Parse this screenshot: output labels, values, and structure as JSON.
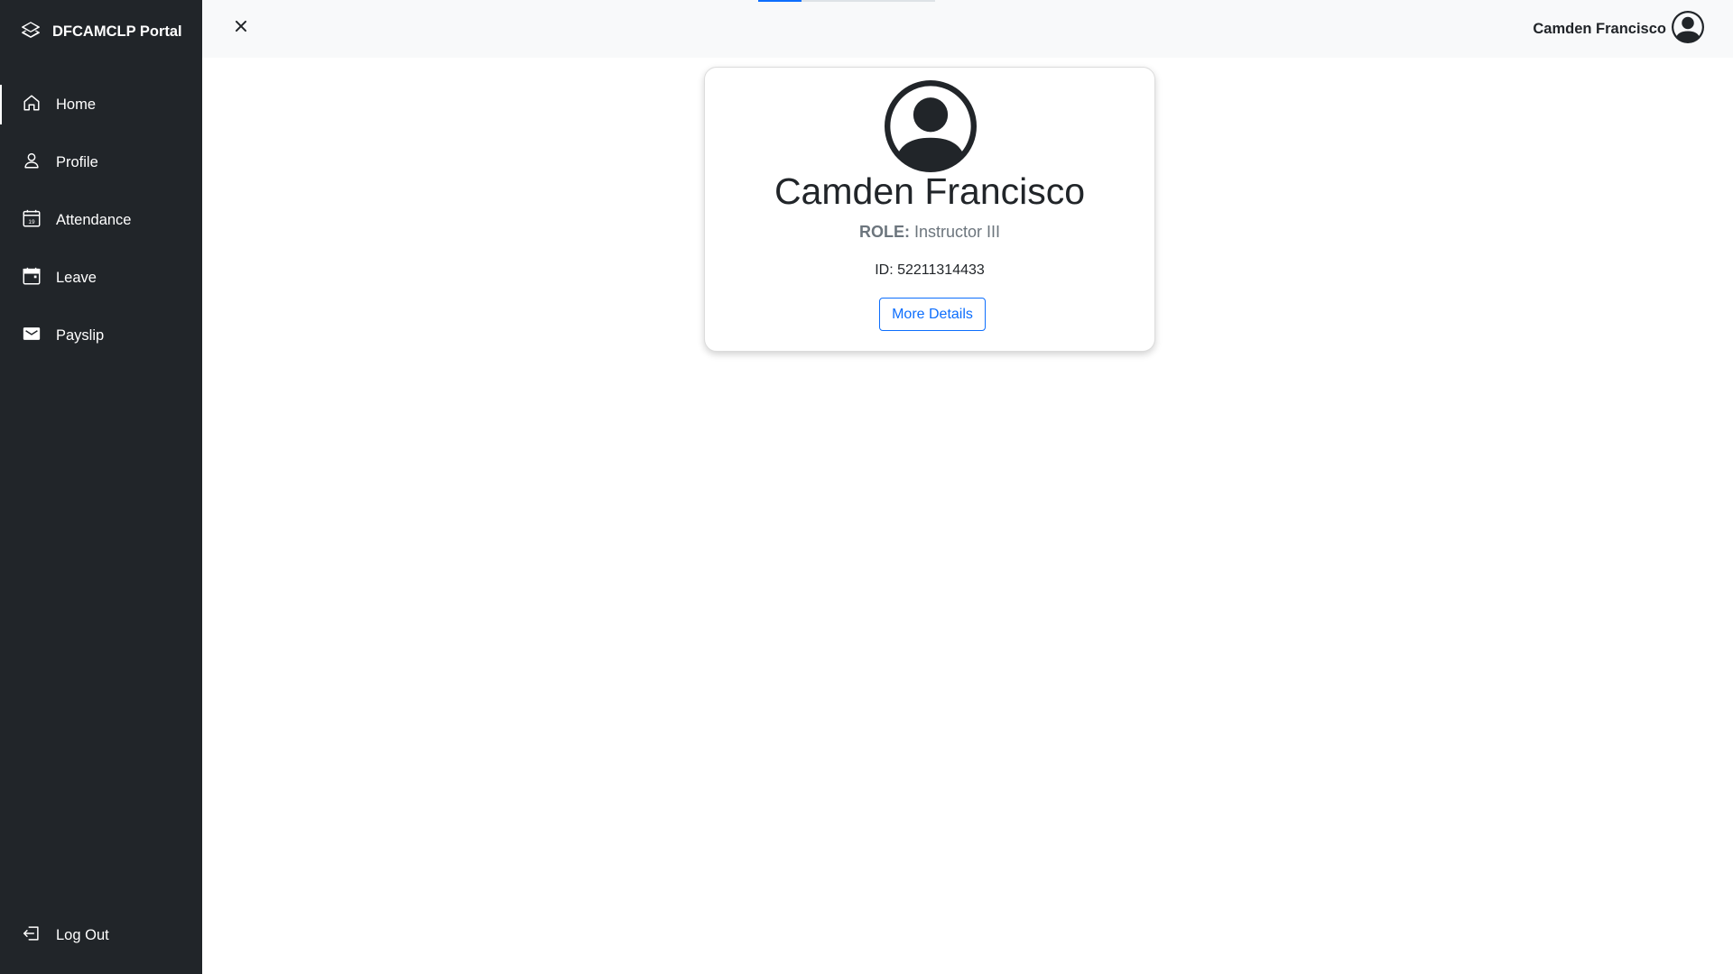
{
  "sidebar": {
    "brand": "DFCAMCLP Portal",
    "items": [
      {
        "label": "Home",
        "icon": "home-icon",
        "active": true
      },
      {
        "label": "Profile",
        "icon": "person-icon"
      },
      {
        "label": "Attendance",
        "icon": "calendar-date-icon"
      },
      {
        "label": "Leave",
        "icon": "calendar-icon"
      },
      {
        "label": "Payslip",
        "icon": "wallet-icon"
      }
    ],
    "logout": "Log Out"
  },
  "topbar": {
    "user_name": "Camden Francisco",
    "close_icon": "close-icon",
    "avatar_icon": "person-circle-icon"
  },
  "profile": {
    "name": "Camden Francisco",
    "role_label": "ROLE:",
    "role_value": "Instructor III",
    "id_label": "ID:",
    "id_value": "52211314433",
    "button_label": "More Details"
  },
  "colors": {
    "sidebar_bg": "#212529",
    "topbar_bg": "#f8f9fa",
    "accent": "#0d6efd"
  }
}
